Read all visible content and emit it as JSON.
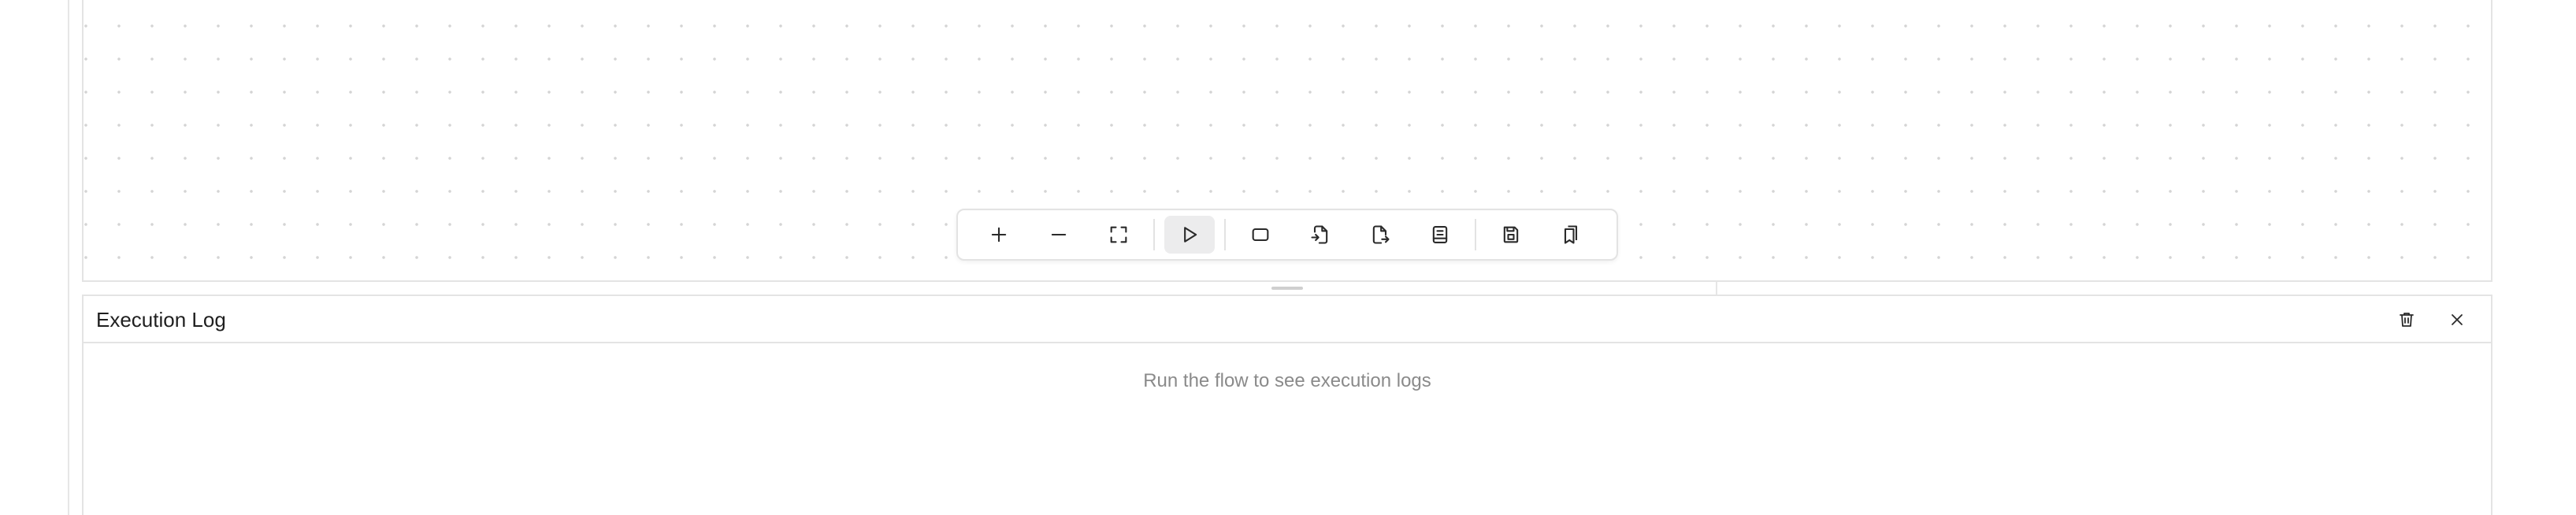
{
  "canvas": {
    "toolbar": {
      "zoom_in": "zoom-in-icon",
      "zoom_out": "zoom-out-icon",
      "fit_view": "fit-view-icon",
      "run": "play-icon",
      "add_node": "node-icon",
      "import": "import-file-icon",
      "export": "export-file-icon",
      "docs": "book-icon",
      "save": "save-icon",
      "templates": "bookmarks-icon"
    }
  },
  "log_panel": {
    "title": "Execution Log",
    "empty_message": "Run the flow to see execution logs",
    "clear_icon": "trash-icon",
    "close_icon": "close-icon"
  },
  "colors": {
    "border": "#e4e4e4",
    "dot": "#d4d4d4",
    "active_button_bg": "#ececed",
    "title_text": "#1f1f1f",
    "muted_text": "#8a8a8a"
  }
}
